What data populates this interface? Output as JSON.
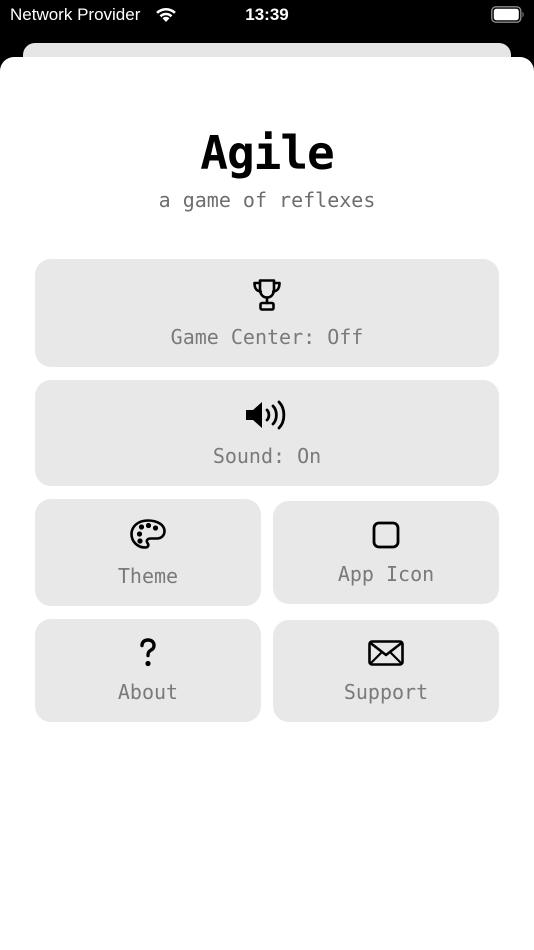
{
  "status_bar": {
    "carrier": "Network Provider",
    "time": "13:39",
    "wifi_icon": "wifi-icon",
    "battery_icon": "battery-full-icon"
  },
  "app": {
    "title": "Agile",
    "subtitle": "a game of reflexes"
  },
  "menu": {
    "game_center": {
      "label": "Game Center: Off",
      "icon": "trophy-icon"
    },
    "sound": {
      "label": "Sound: On",
      "icon": "speaker-wave-icon"
    },
    "theme": {
      "label": "Theme",
      "icon": "palette-icon"
    },
    "app_icon": {
      "label": "App Icon",
      "icon": "rounded-square-icon"
    },
    "about": {
      "label": "About",
      "icon": "question-mark-icon"
    },
    "support": {
      "label": "Support",
      "icon": "envelope-icon"
    }
  },
  "colors": {
    "tile_background": "#e8e8e8",
    "label_text": "#7a7a7a",
    "subtitle_text": "#6e6e6e",
    "title_text": "#000000"
  }
}
